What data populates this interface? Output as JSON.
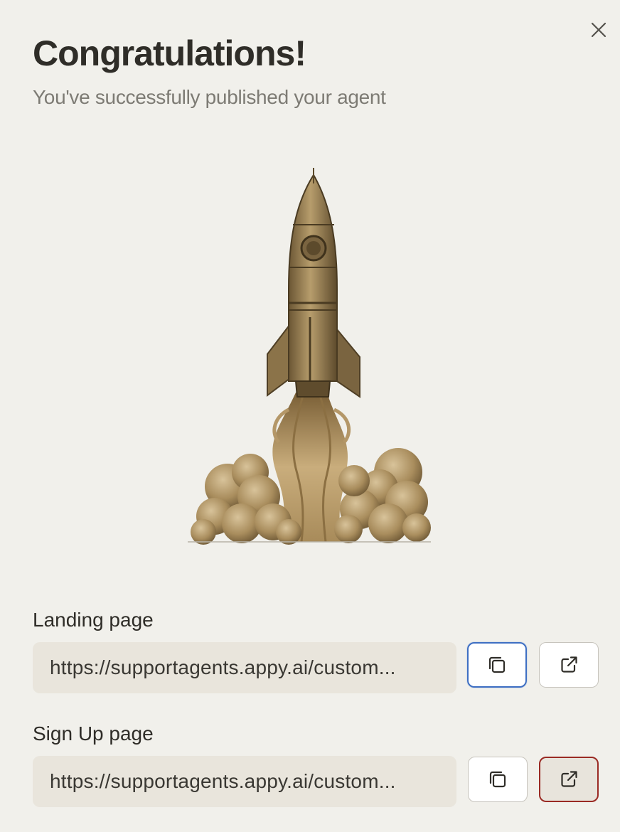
{
  "dialog": {
    "title": "Congratulations!",
    "subtitle": "You've successfully published your agent",
    "close_icon": "close-icon",
    "hero_image": "rocket-launch-illustration"
  },
  "landing": {
    "label": "Landing page",
    "url": "https://supportagents.appy.ai/custom...",
    "copy_icon": "copy-icon",
    "open_icon": "external-link-icon"
  },
  "signup": {
    "label": "Sign Up page",
    "url": "https://supportagents.appy.ai/custom...",
    "copy_icon": "copy-icon",
    "open_icon": "external-link-icon"
  },
  "colors": {
    "background": "#f1f0eb",
    "field_background": "#e9e5dc",
    "focus_border": "#3e6fc3",
    "hover_border": "#9a2a24"
  }
}
